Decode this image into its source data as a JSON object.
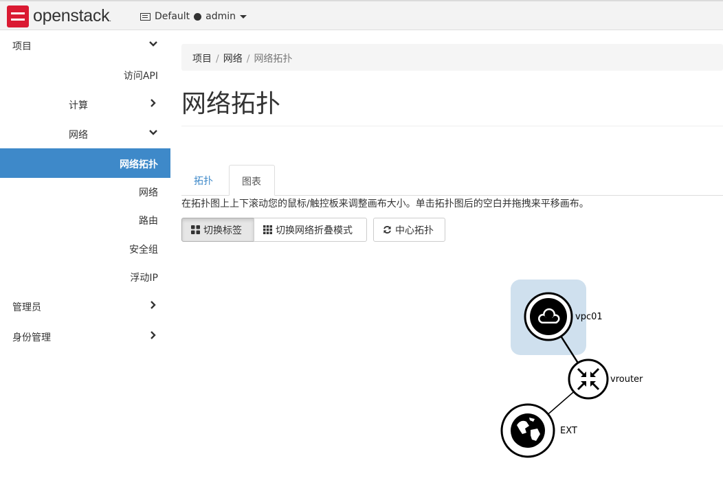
{
  "header": {
    "brand": "openstack",
    "brand_mark": ".",
    "domain": "Default",
    "user": "admin"
  },
  "sidebar": {
    "items": [
      {
        "label": "项目",
        "chevron": "down"
      },
      {
        "label": "访问API"
      },
      {
        "label": "计算",
        "chevron": "right"
      },
      {
        "label": "网络",
        "chevron": "down"
      },
      {
        "label": "网络拓扑",
        "active": true
      },
      {
        "label": "网络"
      },
      {
        "label": "路由"
      },
      {
        "label": "安全组"
      },
      {
        "label": "浮动IP"
      },
      {
        "label": "管理员",
        "chevron": "right"
      },
      {
        "label": "身份管理",
        "chevron": "right"
      }
    ],
    "active_color": "#3e89c9"
  },
  "breadcrumb": [
    "项目",
    "网络",
    "网络拓扑"
  ],
  "page_title": "网络拓扑",
  "tabs": [
    {
      "label": "拓扑",
      "selected": false
    },
    {
      "label": "图表",
      "selected": true
    }
  ],
  "hint": "在拓扑图上上下滚动您的鼠标/触控板来调整画布大小。单击拓扑图后的空白并拖拽来平移画布。",
  "toolbar": {
    "toggle_labels": "切换标签",
    "toggle_collapse": "切换网络折叠模式",
    "center_topology": "中心拓扑"
  },
  "topology": {
    "nodes": [
      {
        "label": "vpc01",
        "kind": "network",
        "icon": "cloud-icon"
      },
      {
        "label": "vrouter",
        "kind": "router",
        "icon": "router-arrows-icon"
      },
      {
        "label": "EXT",
        "kind": "external",
        "icon": "globe-icon"
      }
    ],
    "network_halo_color": "#cfe0ee"
  }
}
